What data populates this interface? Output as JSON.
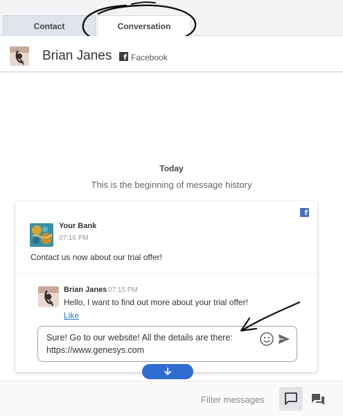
{
  "tabs": [
    {
      "label": "Contact",
      "active": false
    },
    {
      "label": "Conversation",
      "active": true
    }
  ],
  "header": {
    "contact_name": "Brian Janes",
    "channel_icon": "facebook-icon",
    "channel_label": "Facebook"
  },
  "history": {
    "date_label": "Today",
    "start_text": "This is the beginning of message history"
  },
  "post": {
    "author": "Your Bank",
    "time": "07:16 PM",
    "text": "Contact us now about our trial offer!",
    "channel_icon": "facebook-icon"
  },
  "reply": {
    "author": "Brian Janes",
    "time": "07:15 PM",
    "text": "Hello, I want to find out more about your trial offer!",
    "like_label": "Like"
  },
  "composer": {
    "value": "Sure! Go to our website! All the details are there: https://www.genesys.com",
    "emoji_icon": "emoji-icon",
    "send_icon": "send-icon"
  },
  "footer": {
    "filter_label": "Filter messages",
    "active_icon": "chat-bubble-icon",
    "secondary_icon": "conversation-icon"
  },
  "colors": {
    "accent": "#2f6cd0",
    "facebook": "#4a6fb5",
    "link": "#2b74c6"
  }
}
